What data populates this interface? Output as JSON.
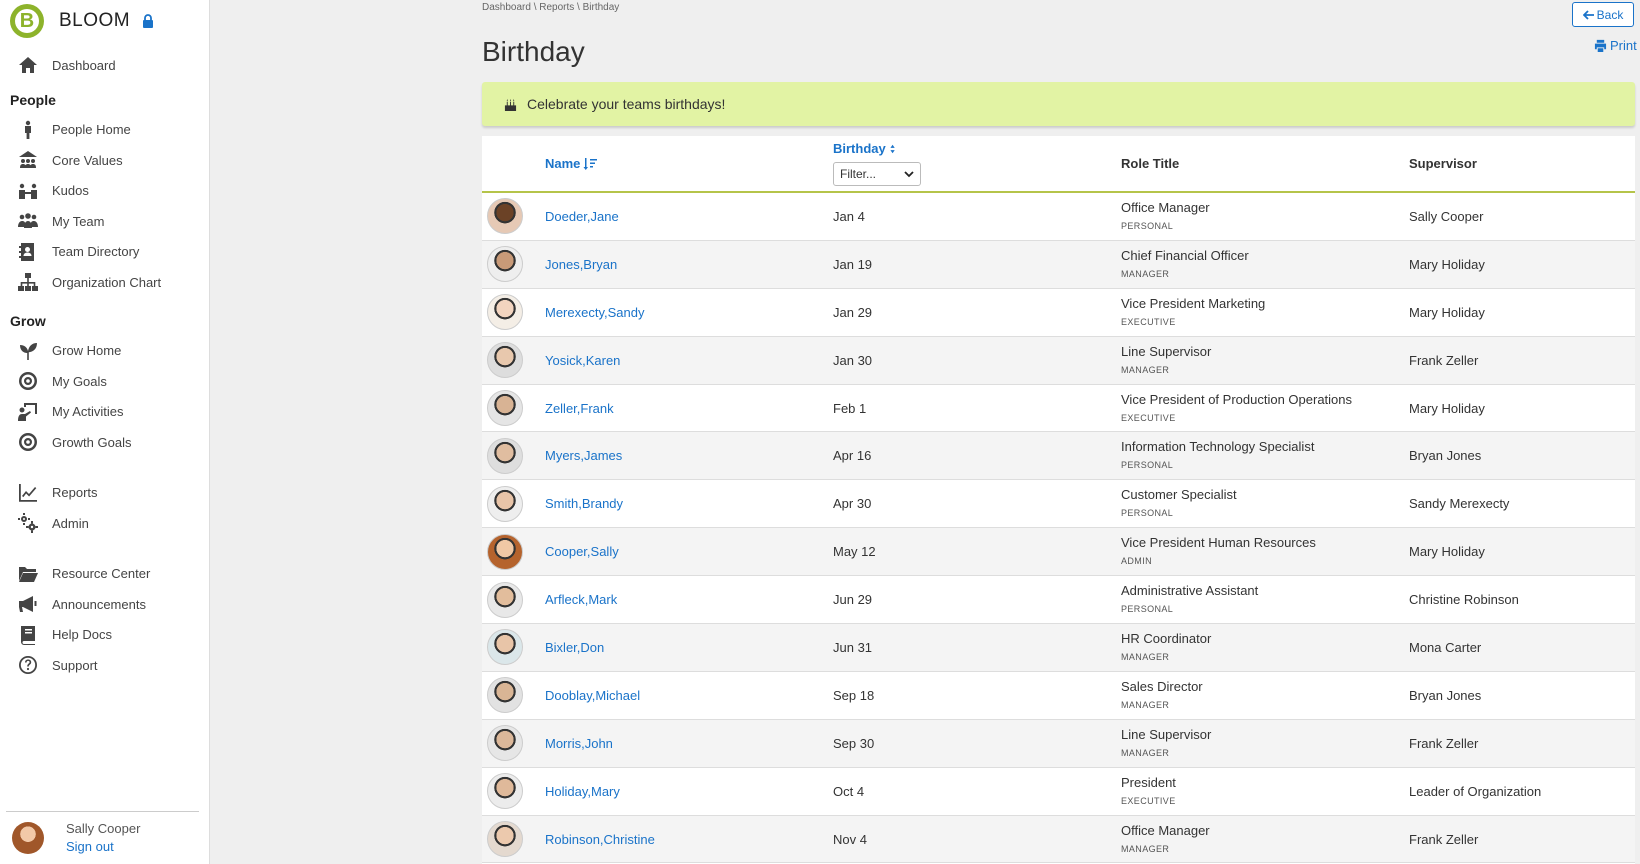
{
  "app": {
    "name": "BLOOM",
    "logo_letter": "B"
  },
  "breadcrumb": "Dashboard \\ Reports \\ Birthday",
  "page": {
    "title": "Birthday",
    "back_label": "Back",
    "print_label": "Print"
  },
  "banner": {
    "text": "Celebrate your teams birthdays!"
  },
  "sidebar": {
    "dashboard": "Dashboard",
    "people_heading": "People",
    "people_items": [
      {
        "label": "People Home",
        "icon": "person-icon"
      },
      {
        "label": "Core Values",
        "icon": "core-values-icon"
      },
      {
        "label": "Kudos",
        "icon": "kudos-icon"
      },
      {
        "label": "My Team",
        "icon": "team-icon"
      },
      {
        "label": "Team Directory",
        "icon": "directory-icon"
      },
      {
        "label": "Organization Chart",
        "icon": "org-chart-icon"
      }
    ],
    "grow_heading": "Grow",
    "grow_items": [
      {
        "label": "Grow Home",
        "icon": "sprout-icon"
      },
      {
        "label": "My Goals",
        "icon": "target-icon"
      },
      {
        "label": "My Activities",
        "icon": "activities-icon"
      },
      {
        "label": "Growth Goals",
        "icon": "target-icon"
      }
    ],
    "admin_items": [
      {
        "label": "Reports",
        "icon": "chart-icon"
      },
      {
        "label": "Admin",
        "icon": "gears-icon"
      }
    ],
    "resource_items": [
      {
        "label": "Resource Center",
        "icon": "folder-icon"
      },
      {
        "label": "Announcements",
        "icon": "megaphone-icon"
      },
      {
        "label": "Help Docs",
        "icon": "book-icon"
      },
      {
        "label": "Support",
        "icon": "question-icon"
      }
    ],
    "user": {
      "name": "Sally Cooper",
      "signout": "Sign out"
    }
  },
  "table": {
    "headers": {
      "name": "Name",
      "birthday": "Birthday",
      "role": "Role Title",
      "supervisor": "Supervisor"
    },
    "filter_placeholder": "Filter...",
    "rows": [
      {
        "name": "Doeder,Jane",
        "birthday": "Jan 4",
        "role": "Office Manager",
        "type": "PERSONAL",
        "supervisor": "Sally Cooper",
        "skin": "#6b4226",
        "bg": "#e6c9b5"
      },
      {
        "name": "Jones,Bryan",
        "birthday": "Jan 19",
        "role": "Chief Financial Officer",
        "type": "MANAGER",
        "supervisor": "Mary Holiday",
        "skin": "#c89a78",
        "bg": "#eee"
      },
      {
        "name": "Merexecty,Sandy",
        "birthday": "Jan 29",
        "role": "Vice President Marketing",
        "type": "EXECUTIVE",
        "supervisor": "Mary Holiday",
        "skin": "#f2d4bf",
        "bg": "#f4eee6"
      },
      {
        "name": "Yosick,Karen",
        "birthday": "Jan 30",
        "role": "Line Supervisor",
        "type": "MANAGER",
        "supervisor": "Frank Zeller",
        "skin": "#e8c8ad",
        "bg": "#ddd"
      },
      {
        "name": "Zeller,Frank",
        "birthday": "Feb 1",
        "role": "Vice President of Production Operations",
        "type": "EXECUTIVE",
        "supervisor": "Mary Holiday",
        "skin": "#d8b394",
        "bg": "#e5e5e5"
      },
      {
        "name": "Myers,James",
        "birthday": "Apr 16",
        "role": "Information Technology Specialist",
        "type": "PERSONAL",
        "supervisor": "Bryan Jones",
        "skin": "#e0bda0",
        "bg": "#dedede"
      },
      {
        "name": "Smith,Brandy",
        "birthday": "Apr 30",
        "role": "Customer Specialist",
        "type": "PERSONAL",
        "supervisor": "Sandy Merexecty",
        "skin": "#e8c4a8",
        "bg": "#eee"
      },
      {
        "name": "Cooper,Sally",
        "birthday": "May 12",
        "role": "Vice President Human Resources",
        "type": "ADMIN",
        "supervisor": "Mary Holiday",
        "skin": "#f0c8a5",
        "bg": "#b5632d"
      },
      {
        "name": "Arfleck,Mark",
        "birthday": "Jun 29",
        "role": "Administrative Assistant",
        "type": "PERSONAL",
        "supervisor": "Christine Robinson",
        "skin": "#e2bd9c",
        "bg": "#e8e8e8"
      },
      {
        "name": "Bixler,Don",
        "birthday": "Jun 31",
        "role": "HR Coordinator",
        "type": "MANAGER",
        "supervisor": "Mona Carter",
        "skin": "#e8c5a8",
        "bg": "#dbe7ea"
      },
      {
        "name": "Dooblay,Michael",
        "birthday": "Sep 18",
        "role": "Sales Director",
        "type": "MANAGER",
        "supervisor": "Bryan Jones",
        "skin": "#d9b595",
        "bg": "#e2e2e2"
      },
      {
        "name": "Morris,John",
        "birthday": "Sep 30",
        "role": "Line Supervisor",
        "type": "MANAGER",
        "supervisor": "Frank Zeller",
        "skin": "#dcb89a",
        "bg": "#e6e6e6"
      },
      {
        "name": "Holiday,Mary",
        "birthday": "Oct 4",
        "role": "President",
        "type": "EXECUTIVE",
        "supervisor": "Leader of Organization",
        "skin": "#dfb99a",
        "bg": "#ececec"
      },
      {
        "name": "Robinson,Christine",
        "birthday": "Nov 4",
        "role": "Office Manager",
        "type": "MANAGER",
        "supervisor": "Frank Zeller",
        "skin": "#ecc9ad",
        "bg": "#e4d9cf"
      }
    ]
  },
  "colors": {
    "link": "#1a73c9",
    "banner": "#e2f3a4",
    "accent_line": "#b5c44a",
    "logo": "#8db32b"
  }
}
